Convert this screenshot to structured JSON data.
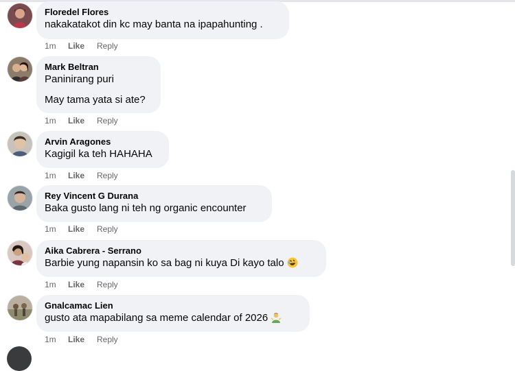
{
  "comments": [
    {
      "author": "Floredel Flores",
      "lines": [
        "nakakatakot din kc may banta na ipapahunting ."
      ],
      "time": "1m",
      "like": "Like",
      "reply": "Reply"
    },
    {
      "author": "Mark Beltran",
      "lines": [
        "Paninirang puri",
        "May tama yata si ate?"
      ],
      "time": "1m",
      "like": "Like",
      "reply": "Reply"
    },
    {
      "author": "Arvin Aragones",
      "lines": [
        "Kagigil ka teh HAHAHA"
      ],
      "time": "1m",
      "like": "Like",
      "reply": "Reply"
    },
    {
      "author": "Rey Vincent G Durana",
      "lines": [
        "Baka gusto lang ni teh ng organic encounter"
      ],
      "time": "1m",
      "like": "Like",
      "reply": "Reply"
    },
    {
      "author": "Aika Cabrera - Serrano",
      "lines": [
        "Barbie yung napansin ko sa bag ni kuya Di kayo talo"
      ],
      "time": "1m",
      "like": "Like",
      "reply": "Reply",
      "emoji": "rolling-on-floor-laughing-emoji"
    },
    {
      "author": "Gnalcamac Lien",
      "lines": [
        "gusto ata mapabilang sa meme calendar of 2026"
      ],
      "time": "1m",
      "like": "Like",
      "reply": "Reply",
      "emoji": "person-shrugging-emoji"
    }
  ],
  "colors": {
    "bubble": "#f0f2f5",
    "meta_text": "#65676b",
    "text": "#050505"
  }
}
